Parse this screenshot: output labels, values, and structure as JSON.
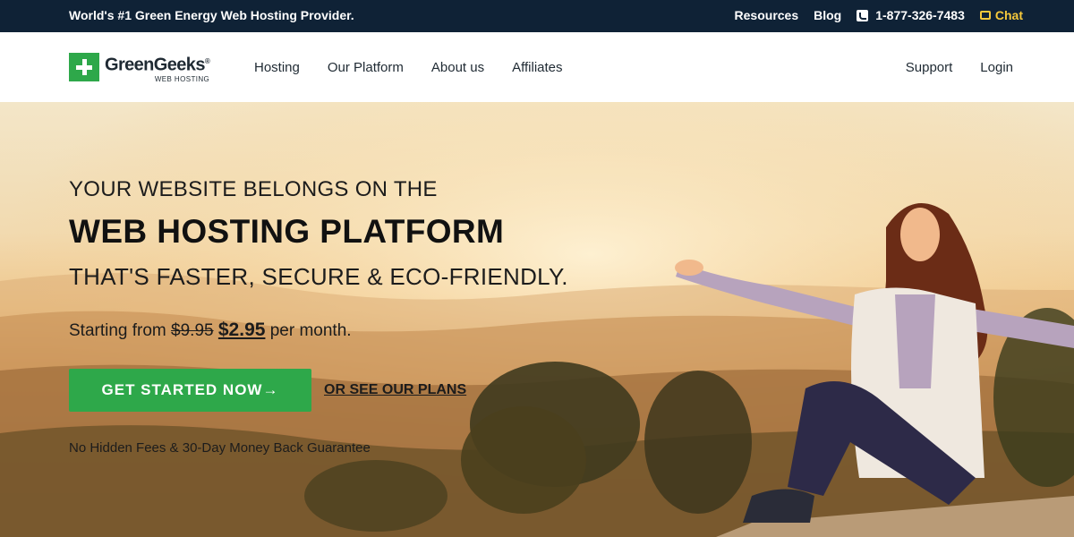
{
  "topbar": {
    "tagline": "World's #1 Green Energy Web Hosting Provider.",
    "resources": "Resources",
    "blog": "Blog",
    "phone": "1-877-326-7483",
    "chat": "Chat"
  },
  "header": {
    "logo_name": "GreenGeeks",
    "logo_sub": "WEB HOSTING",
    "nav": [
      "Hosting",
      "Our Platform",
      "About us",
      "Affiliates"
    ],
    "support": "Support",
    "login": "Login"
  },
  "hero": {
    "line1": "YOUR WEBSITE BELONGS ON THE",
    "line2": "WEB HOSTING PLATFORM",
    "line3": "THAT'S FASTER, SECURE & ECO-FRIENDLY.",
    "price_prefix": "Starting from",
    "price_old": "$9.95",
    "price_new": "$2.95",
    "price_suffix": "per month.",
    "cta_label": "GET STARTED NOW",
    "cta_arrow": "→",
    "plans_link": "OR SEE OUR PLANS",
    "guarantee": "No Hidden Fees & 30-Day Money Back Guarantee"
  },
  "colors": {
    "topbar_bg": "#0f2236",
    "brand_green": "#2ea84a",
    "chat_yellow": "#f6c93b"
  },
  "icons": [
    "phone-icon",
    "chat-icon",
    "logo-plus-icon",
    "arrow-right-icon"
  ]
}
